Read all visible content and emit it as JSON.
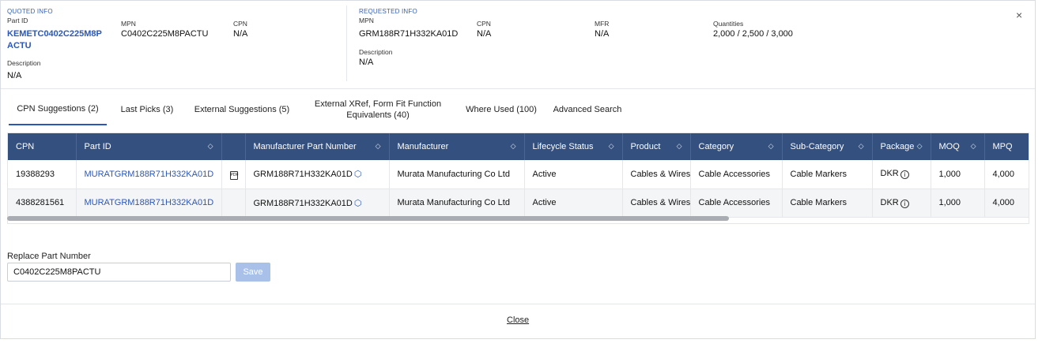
{
  "quoted": {
    "section_title": "QUOTED INFO",
    "part_id_label": "Part ID",
    "part_id_line1": "KEMETC0402C225M8P",
    "part_id_line2": "ACTU",
    "mpn_label": "MPN",
    "mpn": "C0402C225M8PACTU",
    "cpn_label": "CPN",
    "cpn": "N/A",
    "description_label": "Description",
    "description": "N/A"
  },
  "requested": {
    "section_title": "REQUESTED INFO",
    "mpn_label": "MPN",
    "mpn": "GRM188R71H332KA01D",
    "cpn_label": "CPN",
    "cpn": "N/A",
    "mfr_label": "MFR",
    "mfr": "N/A",
    "quantities_label": "Quantities",
    "quantities": "2,000 / 2,500 / 3,000",
    "description_label": "Description",
    "description": "N/A"
  },
  "close_icon": "×",
  "tabs": [
    {
      "label": "CPN Suggestions (2)",
      "active": true
    },
    {
      "label": "Last Picks (3)"
    },
    {
      "label": "External Suggestions (5)"
    },
    {
      "label": "External XRef, Form Fit Function Equivalents (40)"
    },
    {
      "label": "Where Used (100)"
    },
    {
      "label": "Advanced Search"
    }
  ],
  "table": {
    "headers": {
      "cpn": "CPN",
      "part_id": "Part ID",
      "mpn": "Manufacturer Part Number",
      "manufacturer": "Manufacturer",
      "lifecycle": "Lifecycle Status",
      "product": "Product",
      "category": "Category",
      "subcategory": "Sub-Category",
      "package": "Package",
      "moq": "MOQ",
      "mpq": "MPQ"
    },
    "sort_glyph": "◇",
    "rows": [
      {
        "cpn": "19388293",
        "part_id": "MURATGRM188R71H332KA01D",
        "has_pdf": true,
        "mpn": "GRM188R71H332KA01D",
        "manufacturer": "Murata Manufacturing Co Ltd",
        "lifecycle": "Active",
        "product": "Cables & Wires",
        "category": "Cable Accessories",
        "subcategory": "Cable Markers",
        "package": "DKR",
        "moq": "1,000",
        "mpq": "4,000"
      },
      {
        "cpn": "4388281561",
        "part_id": "MURATGRM188R71H332KA01D",
        "has_pdf": false,
        "mpn": "GRM188R71H332KA01D",
        "manufacturer": "Murata Manufacturing Co Ltd",
        "lifecycle": "Active",
        "product": "Cables & Wires",
        "category": "Cable Accessories",
        "subcategory": "Cable Markers",
        "package": "DKR",
        "moq": "1,000",
        "mpq": "4,000"
      }
    ]
  },
  "replace": {
    "label": "Replace Part Number",
    "value": "C0402C225M8PACTU",
    "save_label": "Save"
  },
  "footer": {
    "close_label": "Close"
  }
}
